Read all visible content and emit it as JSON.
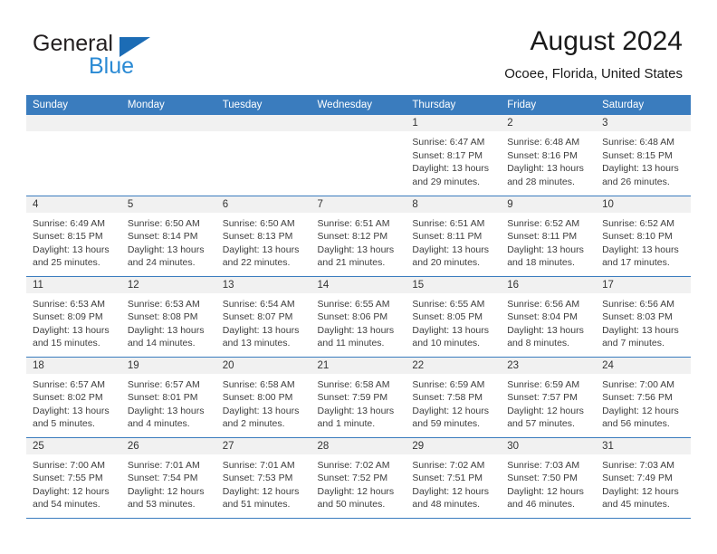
{
  "brand": {
    "name_part1": "General",
    "name_part2": "Blue",
    "triangle_color": "#1c6cb5",
    "blue_text_color": "#2a8ad4"
  },
  "header": {
    "title": "August 2024",
    "subtitle": "Ocoee, Florida, United States",
    "header_bg_color": "#3a7cbe",
    "daynum_band_color": "#f1f1f1"
  },
  "weekday_headers": [
    "Sunday",
    "Monday",
    "Tuesday",
    "Wednesday",
    "Thursday",
    "Friday",
    "Saturday"
  ],
  "weeks": [
    [
      {
        "day": "",
        "sunrise": "",
        "sunset": "",
        "daylight_line1": "",
        "daylight_line2": "",
        "empty": true
      },
      {
        "day": "",
        "sunrise": "",
        "sunset": "",
        "daylight_line1": "",
        "daylight_line2": "",
        "empty": true
      },
      {
        "day": "",
        "sunrise": "",
        "sunset": "",
        "daylight_line1": "",
        "daylight_line2": "",
        "empty": true
      },
      {
        "day": "",
        "sunrise": "",
        "sunset": "",
        "daylight_line1": "",
        "daylight_line2": "",
        "empty": true
      },
      {
        "day": "1",
        "sunrise": "Sunrise: 6:47 AM",
        "sunset": "Sunset: 8:17 PM",
        "daylight_line1": "Daylight: 13 hours",
        "daylight_line2": "and 29 minutes."
      },
      {
        "day": "2",
        "sunrise": "Sunrise: 6:48 AM",
        "sunset": "Sunset: 8:16 PM",
        "daylight_line1": "Daylight: 13 hours",
        "daylight_line2": "and 28 minutes."
      },
      {
        "day": "3",
        "sunrise": "Sunrise: 6:48 AM",
        "sunset": "Sunset: 8:15 PM",
        "daylight_line1": "Daylight: 13 hours",
        "daylight_line2": "and 26 minutes."
      }
    ],
    [
      {
        "day": "4",
        "sunrise": "Sunrise: 6:49 AM",
        "sunset": "Sunset: 8:15 PM",
        "daylight_line1": "Daylight: 13 hours",
        "daylight_line2": "and 25 minutes."
      },
      {
        "day": "5",
        "sunrise": "Sunrise: 6:50 AM",
        "sunset": "Sunset: 8:14 PM",
        "daylight_line1": "Daylight: 13 hours",
        "daylight_line2": "and 24 minutes."
      },
      {
        "day": "6",
        "sunrise": "Sunrise: 6:50 AM",
        "sunset": "Sunset: 8:13 PM",
        "daylight_line1": "Daylight: 13 hours",
        "daylight_line2": "and 22 minutes."
      },
      {
        "day": "7",
        "sunrise": "Sunrise: 6:51 AM",
        "sunset": "Sunset: 8:12 PM",
        "daylight_line1": "Daylight: 13 hours",
        "daylight_line2": "and 21 minutes."
      },
      {
        "day": "8",
        "sunrise": "Sunrise: 6:51 AM",
        "sunset": "Sunset: 8:11 PM",
        "daylight_line1": "Daylight: 13 hours",
        "daylight_line2": "and 20 minutes."
      },
      {
        "day": "9",
        "sunrise": "Sunrise: 6:52 AM",
        "sunset": "Sunset: 8:11 PM",
        "daylight_line1": "Daylight: 13 hours",
        "daylight_line2": "and 18 minutes."
      },
      {
        "day": "10",
        "sunrise": "Sunrise: 6:52 AM",
        "sunset": "Sunset: 8:10 PM",
        "daylight_line1": "Daylight: 13 hours",
        "daylight_line2": "and 17 minutes."
      }
    ],
    [
      {
        "day": "11",
        "sunrise": "Sunrise: 6:53 AM",
        "sunset": "Sunset: 8:09 PM",
        "daylight_line1": "Daylight: 13 hours",
        "daylight_line2": "and 15 minutes."
      },
      {
        "day": "12",
        "sunrise": "Sunrise: 6:53 AM",
        "sunset": "Sunset: 8:08 PM",
        "daylight_line1": "Daylight: 13 hours",
        "daylight_line2": "and 14 minutes."
      },
      {
        "day": "13",
        "sunrise": "Sunrise: 6:54 AM",
        "sunset": "Sunset: 8:07 PM",
        "daylight_line1": "Daylight: 13 hours",
        "daylight_line2": "and 13 minutes."
      },
      {
        "day": "14",
        "sunrise": "Sunrise: 6:55 AM",
        "sunset": "Sunset: 8:06 PM",
        "daylight_line1": "Daylight: 13 hours",
        "daylight_line2": "and 11 minutes."
      },
      {
        "day": "15",
        "sunrise": "Sunrise: 6:55 AM",
        "sunset": "Sunset: 8:05 PM",
        "daylight_line1": "Daylight: 13 hours",
        "daylight_line2": "and 10 minutes."
      },
      {
        "day": "16",
        "sunrise": "Sunrise: 6:56 AM",
        "sunset": "Sunset: 8:04 PM",
        "daylight_line1": "Daylight: 13 hours",
        "daylight_line2": "and 8 minutes."
      },
      {
        "day": "17",
        "sunrise": "Sunrise: 6:56 AM",
        "sunset": "Sunset: 8:03 PM",
        "daylight_line1": "Daylight: 13 hours",
        "daylight_line2": "and 7 minutes."
      }
    ],
    [
      {
        "day": "18",
        "sunrise": "Sunrise: 6:57 AM",
        "sunset": "Sunset: 8:02 PM",
        "daylight_line1": "Daylight: 13 hours",
        "daylight_line2": "and 5 minutes."
      },
      {
        "day": "19",
        "sunrise": "Sunrise: 6:57 AM",
        "sunset": "Sunset: 8:01 PM",
        "daylight_line1": "Daylight: 13 hours",
        "daylight_line2": "and 4 minutes."
      },
      {
        "day": "20",
        "sunrise": "Sunrise: 6:58 AM",
        "sunset": "Sunset: 8:00 PM",
        "daylight_line1": "Daylight: 13 hours",
        "daylight_line2": "and 2 minutes."
      },
      {
        "day": "21",
        "sunrise": "Sunrise: 6:58 AM",
        "sunset": "Sunset: 7:59 PM",
        "daylight_line1": "Daylight: 13 hours",
        "daylight_line2": "and 1 minute."
      },
      {
        "day": "22",
        "sunrise": "Sunrise: 6:59 AM",
        "sunset": "Sunset: 7:58 PM",
        "daylight_line1": "Daylight: 12 hours",
        "daylight_line2": "and 59 minutes."
      },
      {
        "day": "23",
        "sunrise": "Sunrise: 6:59 AM",
        "sunset": "Sunset: 7:57 PM",
        "daylight_line1": "Daylight: 12 hours",
        "daylight_line2": "and 57 minutes."
      },
      {
        "day": "24",
        "sunrise": "Sunrise: 7:00 AM",
        "sunset": "Sunset: 7:56 PM",
        "daylight_line1": "Daylight: 12 hours",
        "daylight_line2": "and 56 minutes."
      }
    ],
    [
      {
        "day": "25",
        "sunrise": "Sunrise: 7:00 AM",
        "sunset": "Sunset: 7:55 PM",
        "daylight_line1": "Daylight: 12 hours",
        "daylight_line2": "and 54 minutes."
      },
      {
        "day": "26",
        "sunrise": "Sunrise: 7:01 AM",
        "sunset": "Sunset: 7:54 PM",
        "daylight_line1": "Daylight: 12 hours",
        "daylight_line2": "and 53 minutes."
      },
      {
        "day": "27",
        "sunrise": "Sunrise: 7:01 AM",
        "sunset": "Sunset: 7:53 PM",
        "daylight_line1": "Daylight: 12 hours",
        "daylight_line2": "and 51 minutes."
      },
      {
        "day": "28",
        "sunrise": "Sunrise: 7:02 AM",
        "sunset": "Sunset: 7:52 PM",
        "daylight_line1": "Daylight: 12 hours",
        "daylight_line2": "and 50 minutes."
      },
      {
        "day": "29",
        "sunrise": "Sunrise: 7:02 AM",
        "sunset": "Sunset: 7:51 PM",
        "daylight_line1": "Daylight: 12 hours",
        "daylight_line2": "and 48 minutes."
      },
      {
        "day": "30",
        "sunrise": "Sunrise: 7:03 AM",
        "sunset": "Sunset: 7:50 PM",
        "daylight_line1": "Daylight: 12 hours",
        "daylight_line2": "and 46 minutes."
      },
      {
        "day": "31",
        "sunrise": "Sunrise: 7:03 AM",
        "sunset": "Sunset: 7:49 PM",
        "daylight_line1": "Daylight: 12 hours",
        "daylight_line2": "and 45 minutes."
      }
    ]
  ]
}
